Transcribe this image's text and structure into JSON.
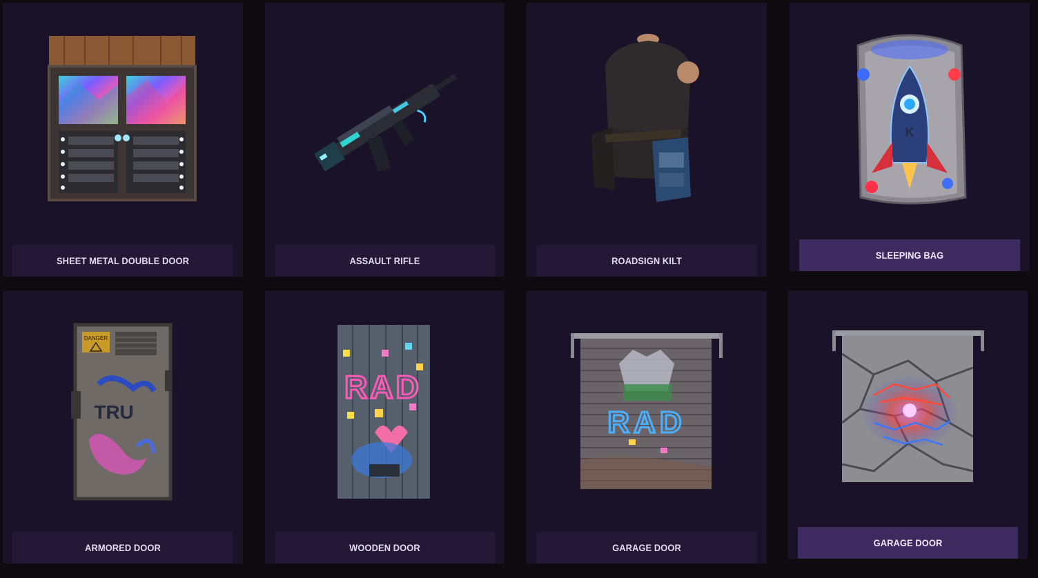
{
  "items": [
    {
      "name": "SHEET METAL DOUBLE DOOR",
      "icon": "sheet-metal-double-door-icon"
    },
    {
      "name": "ASSAULT RIFLE",
      "icon": "assault-rifle-icon"
    },
    {
      "name": "ROADSIGN KILT",
      "icon": "roadsign-kilt-icon"
    },
    {
      "name": "SLEEPING BAG",
      "icon": "sleeping-bag-icon",
      "highlighted": true
    },
    {
      "name": "ARMORED DOOR",
      "icon": "armored-door-icon"
    },
    {
      "name": "WOODEN DOOR",
      "icon": "wooden-door-icon"
    },
    {
      "name": "GARAGE DOOR",
      "icon": "garage-door-icon"
    },
    {
      "name": "GARAGE DOOR",
      "icon": "garage-door-icon",
      "highlighted": true
    }
  ],
  "art_text": {
    "danger": "DANGER",
    "armored_graffiti": "TRU",
    "rad": "RAD",
    "bag_letter": "K"
  },
  "colors": {
    "page_background": "#0d0b10",
    "card_background": "#1a1229",
    "label_background": "#241837",
    "label_highlight": "#3d2a5e",
    "label_text": "#e3d8f2"
  }
}
